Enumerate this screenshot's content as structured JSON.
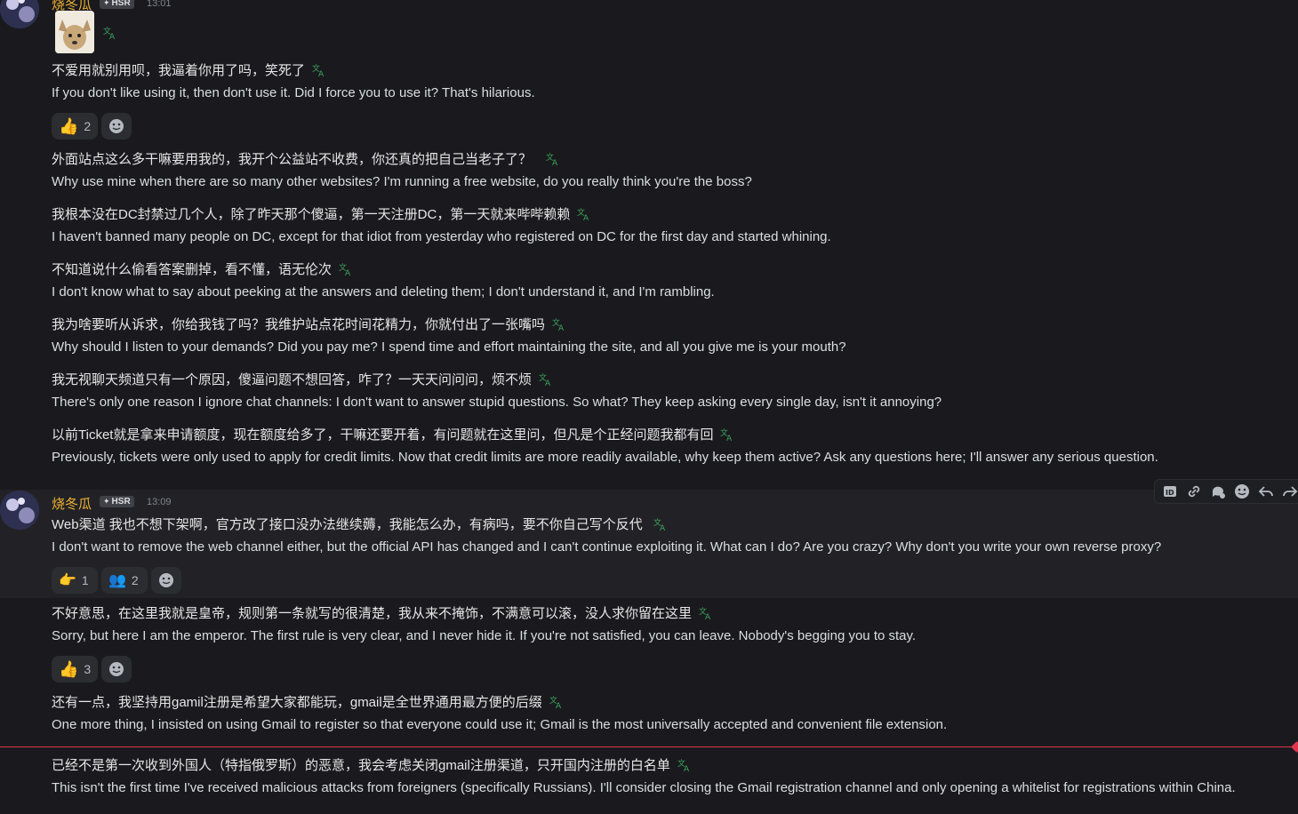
{
  "user": {
    "name": "烧冬瓜",
    "tag": "HSR"
  },
  "group1": {
    "time": "13:01"
  },
  "group2": {
    "time": "13:09"
  },
  "messages": [
    {
      "cn": "不爱用就别用呗，我逼着你用了吗，笑死了",
      "en": "If you don't like using it, then don't use it. Did I force you to use it? That's hilarious."
    },
    {
      "cn": "外面站点这么多干嘛要用我的，我开个公益站不收费，你还真的把自己当老子了？",
      "en": "Why use mine when there are so many other websites? I'm running a free website, do you really think you're the boss?"
    },
    {
      "cn": "我根本没在DC封禁过几个人，除了昨天那个傻逼，第一天注册DC，第一天就来哔哔赖赖",
      "en": "I haven't banned many people on DC, except for that idiot from yesterday who registered on DC for the first day and started whining."
    },
    {
      "cn": "不知道说什么偷看答案删掉，看不懂，语无伦次",
      "en": "I don't know what to say about peeking at the answers and deleting them; I don't understand it, and I'm rambling."
    },
    {
      "cn": "我为啥要听从诉求，你给我钱了吗？我维护站点花时间花精力，你就付出了一张嘴吗",
      "en": "Why should I listen to your demands? Did you pay me? I spend time and effort maintaining the site, and all you give me is your mouth?"
    },
    {
      "cn": "我无视聊天频道只有一个原因，傻逼问题不想回答，咋了？一天天问问问，烦不烦",
      "en": "There's only one reason I ignore chat channels: I don't want to answer stupid questions. So what? They keep asking every single day, isn't it annoying?"
    },
    {
      "cn": "以前Ticket就是拿来申请额度，现在额度给多了，干嘛还要开着，有问题就在这里问，但凡是个正经问题我都有回",
      "en": "Previously, tickets were only used to apply for credit limits. Now that credit limits are more readily available, why keep them active? Ask any questions here; I'll answer any serious question."
    },
    {
      "cn": "Web渠道 我也不想下架啊，官方改了接口没办法继续薅，我能怎么办，有病吗，要不你自己写个反代",
      "en": "I don't want to remove the web channel either, but the official API has changed and I can't continue exploiting it. What can I do? Are you crazy? Why don't you write your own reverse proxy?"
    },
    {
      "cn": "不好意思，在这里我就是皇帝，规则第一条就写的很清楚，我从来不掩饰，不满意可以滚，没人求你留在这里",
      "en": "Sorry, but here I am the emperor. The first rule is very clear, and I never hide it. If you're not satisfied, you can leave. Nobody's begging you to stay."
    },
    {
      "cn": "还有一点，我坚持用gamil注册是希望大家都能玩，gmail是全世界通用最方便的后缀",
      "en": "One more thing, I insisted on using Gmail to register so that everyone could use it; Gmail is the most universally accepted and convenient file extension."
    },
    {
      "cn": "已经不是第一次收到外国人（特指俄罗斯）的恶意，我会考虑关闭gmail注册渠道，只开国内注册的白名单",
      "en": "This isn't the first time I've received malicious attacks from foreigners (specifically Russians). I'll consider closing the Gmail registration channel and only opening a whitelist for registrations within China."
    }
  ],
  "reactions": {
    "r1": [
      {
        "emoji": "thumbs-up",
        "count": "2"
      }
    ],
    "r2": [
      {
        "emoji": "point-right",
        "count": "1"
      },
      {
        "emoji": "people",
        "count": "2"
      }
    ],
    "r3": [
      {
        "emoji": "thumbs-up",
        "count": "3"
      }
    ]
  },
  "icons": {
    "translate_color": "#3ba55d",
    "accent": "#e0354c",
    "username_color": "#f0b232"
  }
}
